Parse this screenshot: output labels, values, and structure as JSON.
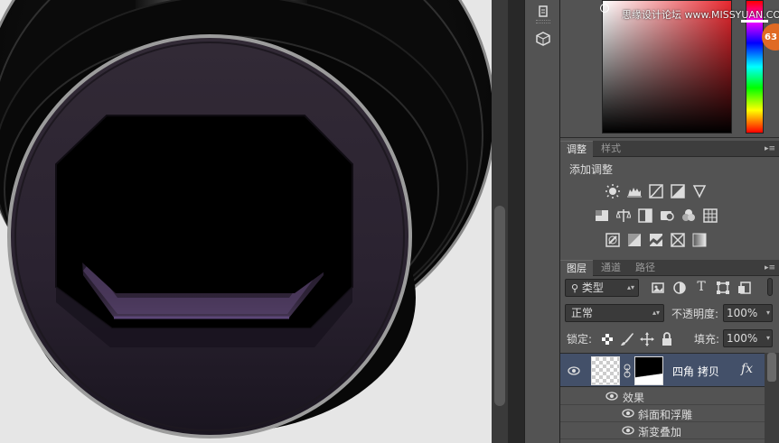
{
  "colors": {
    "canvas_bg": "#e6e6e6",
    "panel_bg": "#535353",
    "selected_layer": "#435069",
    "accent_badge": "#e06a24"
  },
  "color_panel": {
    "watermark": "思缘设计论坛 www.MISSYUAN.COM",
    "badge_text": "63"
  },
  "adjustments_panel": {
    "tabs": [
      "调整",
      "样式"
    ],
    "title": "添加调整",
    "icons_row1": [
      "brightness-icon",
      "levels-icon",
      "curves-icon",
      "exposure-icon",
      "vibrance-icon"
    ],
    "icons_row2": [
      "hue-saturation-icon",
      "color-balance-icon",
      "black-white-icon",
      "photo-filter-icon",
      "channel-mixer-icon",
      "color-lookup-icon"
    ],
    "icons_row3": [
      "invert-icon",
      "posterize-icon",
      "threshold-icon",
      "selective-color-icon",
      "gradient-map-icon"
    ]
  },
  "layers_panel": {
    "tabs": [
      "图层",
      "通道",
      "路径"
    ],
    "filter_kind": "类型",
    "blend_mode": "正常",
    "opacity_label": "不透明度:",
    "opacity_value": "100%",
    "lock_label": "锁定:",
    "fill_label": "填充:",
    "fill_value": "100%",
    "layers": [
      {
        "name": "四角 拷贝",
        "fx": "fx",
        "effects_label": "效果",
        "effects": [
          "斜面和浮雕",
          "渐变叠加"
        ]
      }
    ]
  }
}
